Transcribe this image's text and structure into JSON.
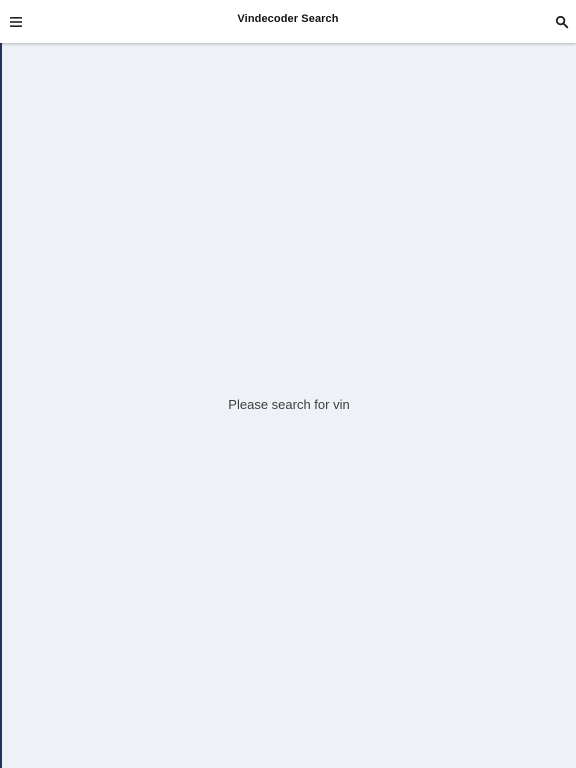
{
  "app_bar": {
    "title": "Vindecoder Search",
    "left_icon": "menu-icon",
    "right_icon": "search-icon"
  },
  "main": {
    "empty_message": "Please search for vin"
  },
  "colors": {
    "app_bar_background": "#ffffff",
    "page_background": "#eef2f7",
    "left_edge": "#24335a",
    "text": "#111111"
  }
}
